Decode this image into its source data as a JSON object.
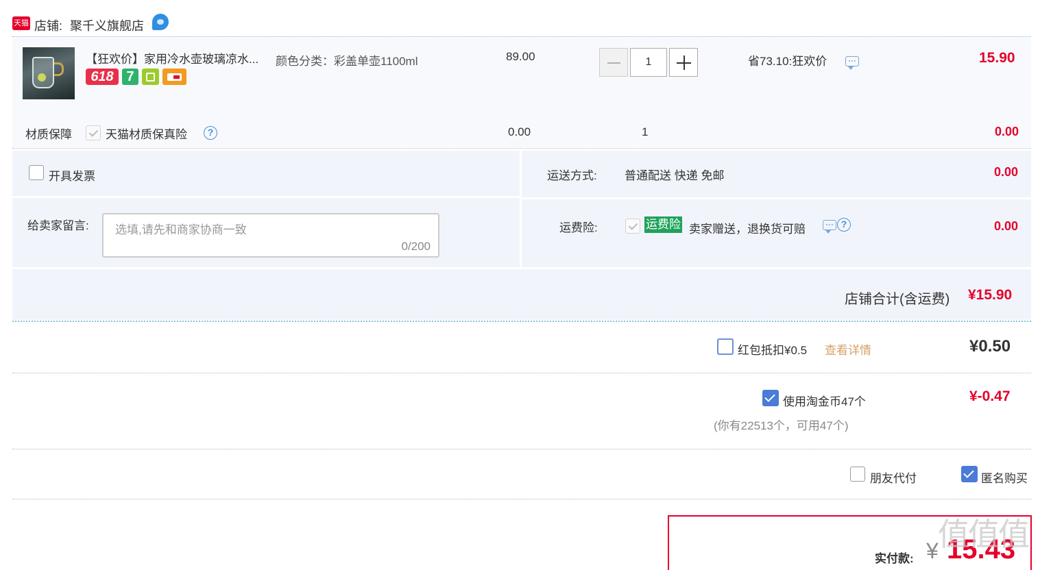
{
  "shop": {
    "platform_badge": "天猫",
    "label": "店铺:",
    "name": "聚千义旗舰店"
  },
  "item": {
    "title": "【狂欢价】家用冷水壶玻璃凉水...",
    "spec": "颜色分类：彩盖单壶1100ml",
    "price": "89.00",
    "quantity": "1",
    "promo": "省73.10:狂欢价",
    "total": "15.90",
    "badges": [
      "618",
      "7"
    ]
  },
  "insurance": {
    "label": "材质保障",
    "name": "天猫材质保真险",
    "price": "0.00",
    "quantity": "1",
    "total": "0.00"
  },
  "invoice": {
    "label": "开具发票"
  },
  "shipping": {
    "label": "运送方式:",
    "method": "普通配送 快递 免邮",
    "fee": "0.00"
  },
  "message": {
    "label": "给卖家留言:",
    "placeholder": "选填,请先和商家协商一致",
    "counter": "0/200"
  },
  "freight_insurance": {
    "label": "运费险:",
    "tag": "运费险",
    "desc": "卖家赠送，退换货可赔",
    "fee": "0.00"
  },
  "shop_total": {
    "label": "店铺合计(含运费)",
    "value": "¥15.90"
  },
  "red_packet": {
    "label": "红包抵扣¥0.5",
    "link": "查看详情",
    "value": "¥0.50"
  },
  "coins": {
    "label": "使用淘金币47个",
    "note": "(你有22513个，可用47个)",
    "value": "¥-0.47"
  },
  "options": {
    "friend_pay": "朋友代付",
    "anonymous": "匿名购买"
  },
  "pay": {
    "label": "实付款:",
    "currency": "¥",
    "amount": "15.43"
  },
  "watermark": "值值值"
}
